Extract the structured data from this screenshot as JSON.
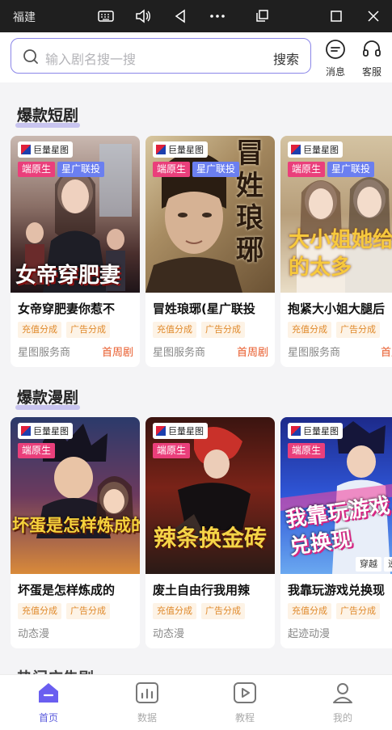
{
  "titlebar": {
    "app_title": "福建",
    "icons": [
      "keyboard-icon",
      "volume-icon",
      "back-icon",
      "more-icon",
      "popout-icon",
      "maximize-icon",
      "close-icon"
    ]
  },
  "search": {
    "placeholder": "输入剧名搜一搜",
    "button": "搜索"
  },
  "header_actions": {
    "messages": "消息",
    "support": "客服"
  },
  "sections": [
    {
      "title": "爆款短剧",
      "cards": [
        {
          "poster_text": "女帝穿肥妻",
          "logo": "巨量星图",
          "tags": [
            "端原生",
            "星广联投"
          ],
          "title": "女帝穿肥妻你惹不",
          "chips": [
            "充值分成",
            "广告分成"
          ],
          "provider": "星图服务商",
          "badge": "首周剧"
        },
        {
          "poster_text": "冒姓琅琊",
          "logo": "巨量星图",
          "tags": [
            "端原生",
            "星广联投"
          ],
          "title": "冒姓琅琊(星广联投",
          "chips": [
            "充值分成",
            "广告分成"
          ],
          "provider": "星图服务商",
          "badge": "首周剧"
        },
        {
          "poster_text": "大小姐她给的太多",
          "logo": "巨量星图",
          "tags": [
            "端原生",
            "星广联投"
          ],
          "title": "抱紧大小姐大腿后",
          "chips": [
            "充值分成",
            "广告分成"
          ],
          "provider": "星图服务商",
          "badge": "首周"
        }
      ]
    },
    {
      "title": "爆款漫剧",
      "cards": [
        {
          "poster_text": "坏蛋是怎样炼成的",
          "logo": "巨量星图",
          "tags": [
            "端原生"
          ],
          "title": "坏蛋是怎样炼成的",
          "chips": [
            "充值分成",
            "广告分成"
          ],
          "provider": "动态漫",
          "badge": ""
        },
        {
          "poster_text": "辣条换金砖",
          "logo": "巨量星图",
          "tags": [
            "端原生"
          ],
          "title": "废土自由行我用辣",
          "chips": [
            "充值分成",
            "广告分成"
          ],
          "provider": "动态漫",
          "badge": ""
        },
        {
          "poster_text": "我靠玩游戏兑换现",
          "logo": "巨量星图",
          "tags": [
            "端原生"
          ],
          "title": "我靠玩游戏兑换现",
          "chips": [
            "充值分成",
            "广告分成"
          ],
          "provider": "起迹动漫",
          "badge": "",
          "corner_tags": [
            "穿越",
            "逆袭"
          ]
        }
      ]
    }
  ],
  "peek_section_title": "热门广告剧",
  "bottom_nav": [
    {
      "label": "首页",
      "icon": "home-icon",
      "active": true
    },
    {
      "label": "数据",
      "icon": "chart-icon",
      "active": false
    },
    {
      "label": "教程",
      "icon": "play-icon",
      "active": false
    },
    {
      "label": "我的",
      "icon": "user-icon",
      "active": false
    }
  ],
  "colors": {
    "accent": "#5b5bdc",
    "native_tag": "#ea3f7b",
    "star_tag": "#6b7ff0",
    "chip_text": "#e08a2c",
    "badge": "#e85a2a"
  }
}
